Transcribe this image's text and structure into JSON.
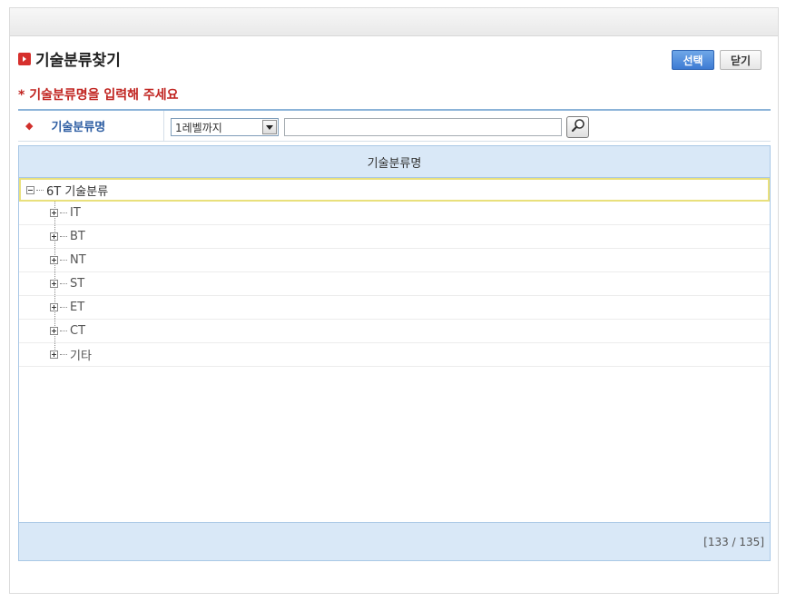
{
  "header": {
    "title": "기술분류찾기",
    "select_button": "선택",
    "close_button": "닫기"
  },
  "notice": "* 기술분류명을 입력해 주세요",
  "search": {
    "label": "기술분류명",
    "level_select": {
      "selected": "1레벨까지"
    },
    "input_value": "",
    "button_icon": "magnifier-icon"
  },
  "tree": {
    "column_header": "기술분류명",
    "root": {
      "label": "6T 기술분류",
      "expanded": true
    },
    "children": [
      {
        "label": "IT"
      },
      {
        "label": "BT"
      },
      {
        "label": "NT"
      },
      {
        "label": "ST"
      },
      {
        "label": "ET"
      },
      {
        "label": "CT"
      },
      {
        "label": "기타"
      }
    ],
    "footer_count": "[133 / 135]"
  },
  "colors": {
    "accent_red": "#d6302d",
    "header_blue": "#d9e8f7",
    "select_button_blue": "#3d7bd3",
    "highlight_border": "#e9e07c"
  }
}
